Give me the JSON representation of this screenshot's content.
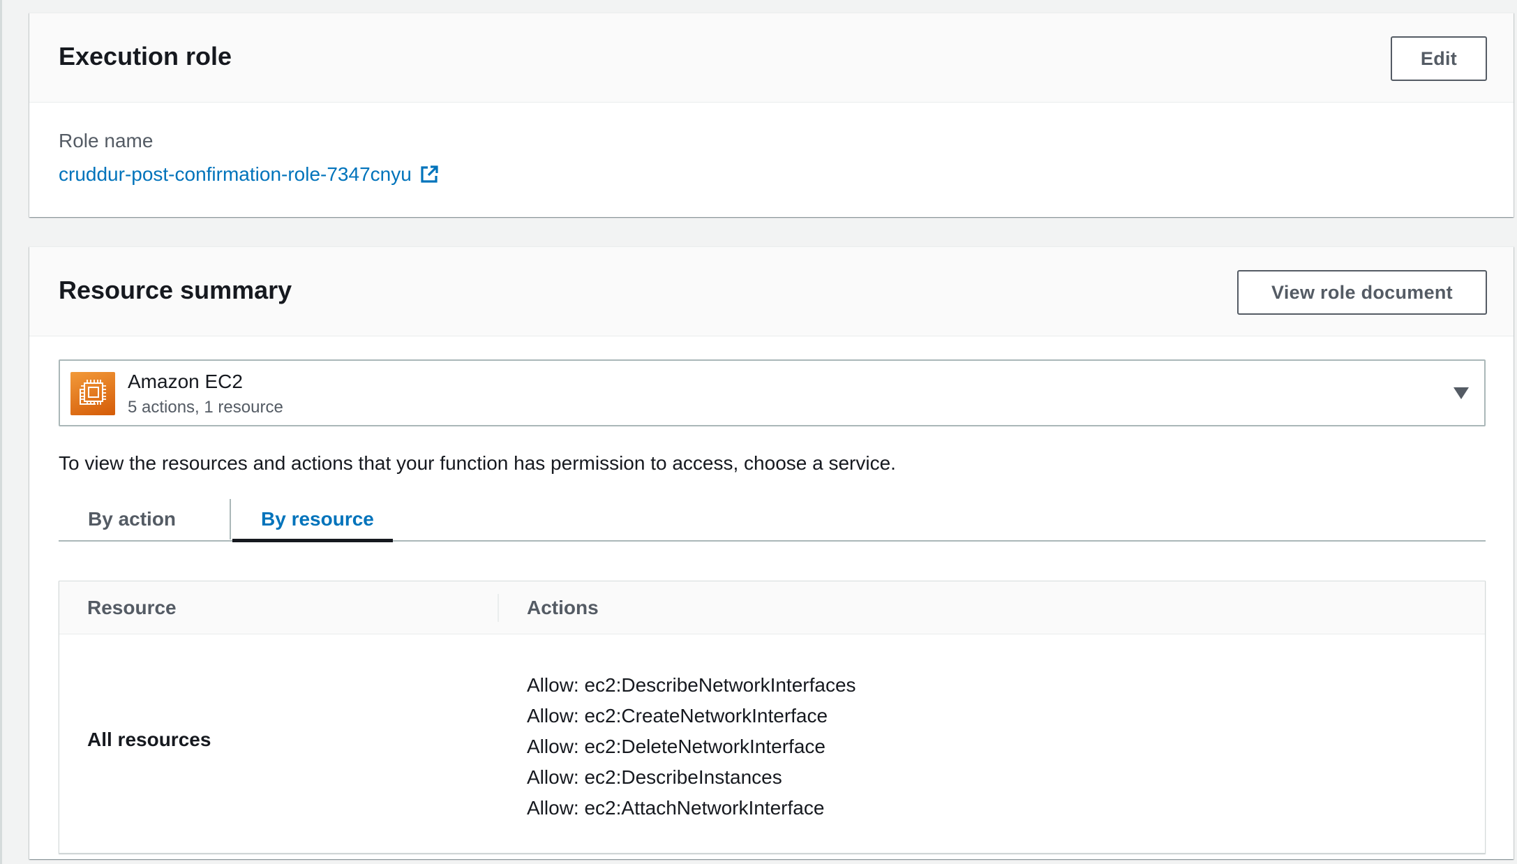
{
  "execution_role": {
    "title": "Execution role",
    "edit_label": "Edit",
    "role_name_label": "Role name",
    "role_name": "cruddur-post-confirmation-role-7347cnyu"
  },
  "resource_summary": {
    "title": "Resource summary",
    "view_doc_label": "View role document",
    "service": {
      "name": "Amazon EC2",
      "summary": "5 actions, 1 resource",
      "icon": "ec2-chip-icon"
    },
    "help_text": "To view the resources and actions that your function has permission to access, choose a service.",
    "tabs": [
      {
        "label": "By action",
        "selected": false
      },
      {
        "label": "By resource",
        "selected": true
      }
    ],
    "table": {
      "columns": [
        "Resource",
        "Actions"
      ],
      "rows": [
        {
          "resource": "All resources",
          "actions": [
            "Allow: ec2:DescribeNetworkInterfaces",
            "Allow: ec2:CreateNetworkInterface",
            "Allow: ec2:DeleteNetworkInterface",
            "Allow: ec2:DescribeInstances",
            "Allow: ec2:AttachNetworkInterface"
          ]
        }
      ]
    }
  },
  "colors": {
    "link": "#0073bb",
    "service_icon": "#e07b1e",
    "panel_header_bg": "#fafafa",
    "page_bg": "#f2f3f3"
  }
}
